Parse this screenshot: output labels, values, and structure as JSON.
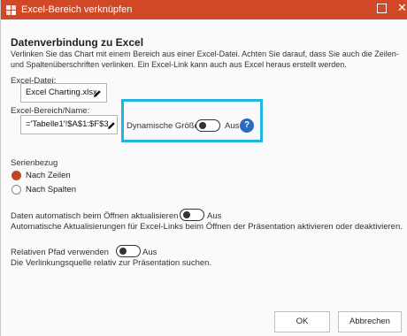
{
  "window": {
    "title": "Excel-Bereich verknüpfen",
    "maximize_label": "",
    "close_label": "✕"
  },
  "connection": {
    "heading": "Datenverbindung zu Excel",
    "description": "Verlinken Sie das Chart mit einem Bereich aus einer Excel-Datei. Achten Sie darauf, dass Sie auch die Zeilen- und Spaltenüberschriften verlinken. Ein Excel-Link kann auch aus Excel heraus erstellt werden."
  },
  "excel_file": {
    "label": "Excel-Datei:",
    "value": "Excel Charting.xlsx"
  },
  "range": {
    "label": "Excel-Bereich/Name:",
    "value": "='Tabelle1'!$A$1:$F$3",
    "dynamic_label": "Dynamische Größe",
    "dynamic_state": "Aus",
    "help": "?"
  },
  "series": {
    "label": "Serienbezug",
    "options": [
      {
        "label": "Nach Zeilen",
        "selected": true
      },
      {
        "label": "Nach Spalten",
        "selected": false
      }
    ]
  },
  "auto_update": {
    "label": "Daten automatisch beim Öffnen aktualisieren",
    "state": "Aus",
    "description": "Automatische Aktualisierungen für Excel-Links beim Öffnen der Präsentation aktivieren oder deaktivieren."
  },
  "relative_path": {
    "label": "Relativen Pfad verwenden",
    "state": "Aus",
    "description": "Die Verlinkungsquelle relativ zur Präsentation suchen."
  },
  "buttons": {
    "ok": "OK",
    "cancel": "Abbrechen"
  },
  "colors": {
    "titlebar": "#d24726",
    "highlight": "#1fb6e5",
    "radio_selected": "#c4441f",
    "help": "#2b6bbf"
  },
  "icons": {
    "title": "app-icon",
    "edit": "pencil-icon",
    "help": "question-icon"
  }
}
